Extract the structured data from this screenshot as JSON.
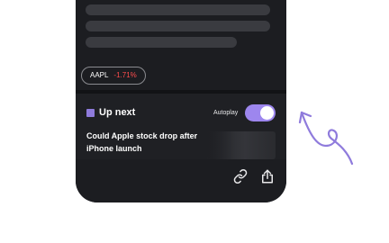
{
  "article": {
    "skeleton_lines": 3,
    "ticker": {
      "symbol": "AAPL",
      "change": "-1.71%",
      "change_color": "#ff4d4d"
    }
  },
  "up_next": {
    "title": "Up next",
    "accent_color": "#8f7bdc",
    "autoplay": {
      "label": "Autoplay",
      "enabled": true,
      "toggle_color": "#9d86ee"
    },
    "headline": "Could Apple stock drop after iPhone launch"
  },
  "toolbar": {
    "icons": [
      "link-icon",
      "share-icon"
    ]
  },
  "annotation": {
    "icon": "curved-arrow-icon",
    "color": "#8f7bdc"
  }
}
